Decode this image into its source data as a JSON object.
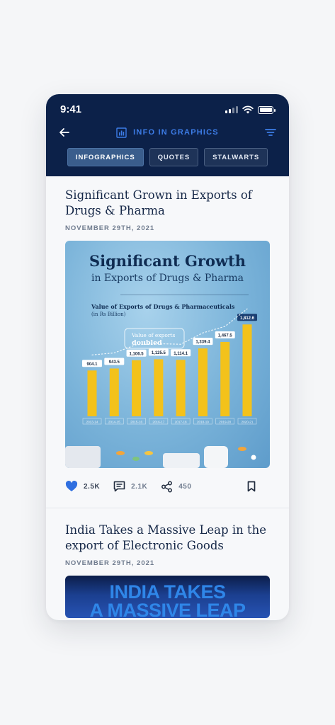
{
  "status_bar": {
    "time": "9:41"
  },
  "header": {
    "title": "INFO IN GRAPHICS",
    "tabs": [
      {
        "label": "INFOGRAPHICS",
        "active": true
      },
      {
        "label": "QUOTES",
        "active": false
      },
      {
        "label": "STALWARTS",
        "active": false
      }
    ]
  },
  "posts": [
    {
      "title": "Significant Grown in Exports of Drugs & Pharma",
      "date": "NOVEMBER 29TH, 2021",
      "image": {
        "headline": "Significant Growth",
        "subheadline": "in Exports of Drugs & Pharma",
        "callout": "Value of exports doubled"
      },
      "likes": "2.5K",
      "comments": "2.1K",
      "shares": "450"
    },
    {
      "title": "India Takes a Massive Leap in the export of Electronic Goods",
      "date": "NOVEMBER 29TH, 2021",
      "image": {
        "headline_line1": "INDIA TAKES",
        "headline_line2": "A MASSIVE LEAP"
      }
    }
  ],
  "chart_data": {
    "type": "bar",
    "title": "Value of Exports of Drugs & Pharmaceuticals",
    "ylabel": "(in Rs Billion)",
    "categories": [
      "2013-14",
      "2014-15",
      "2015-16",
      "2016-17",
      "2017-18",
      "2018-19",
      "2019-20",
      "2020-21"
    ],
    "values": [
      904.1,
      943.5,
      1106.5,
      1125.5,
      1114.1,
      1339.4,
      1467.5,
      1812.6
    ],
    "value_labels": [
      "904.1",
      "943.5",
      "1,106.5",
      "1,125.5",
      "1,114.1",
      "1,339.4",
      "1,467.5",
      "1,812.6"
    ],
    "bar_color": "#f3c21b",
    "highlight_label_index": 7
  },
  "colors": {
    "header_bg": "#0c2149",
    "accent": "#3d7de8",
    "like": "#2f6fe0"
  }
}
